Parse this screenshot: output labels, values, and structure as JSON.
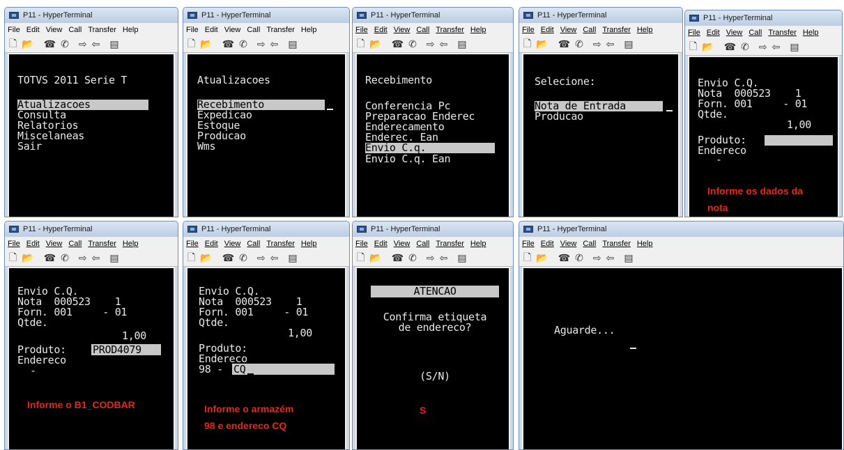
{
  "window_title": "P11 - HyperTerminal",
  "menu": [
    "File",
    "Edit",
    "View",
    "Call",
    "Transfer",
    "Help"
  ],
  "toolbar_icons": [
    "new-icon",
    "open-icon",
    "connect-icon",
    "disconnect-icon",
    "send-icon",
    "receive-icon",
    "properties-icon"
  ],
  "screens": {
    "s1": {
      "title": "TOTVS 2011 Serie T",
      "items": [
        "Atualizacoes",
        "Consulta",
        "Relatorios",
        "Miscelaneas",
        "Sair"
      ]
    },
    "s2": {
      "title": "Atualizacoes",
      "items": [
        "Recebimento",
        "Expedicao",
        "Estoque",
        "Producao",
        "Wms"
      ]
    },
    "s3": {
      "title": "Recebimento",
      "items": [
        "Conferencia Pc",
        "Preparacao Enderec",
        "Enderecamento",
        "Enderec. Ean",
        "Envio C.q.",
        "Envio C.q. Ean"
      ]
    },
    "s4": {
      "title": "Selecione:",
      "items": [
        "Nota de Entrada",
        "Producao"
      ]
    },
    "s5": {
      "lines": [
        "Envio C.Q.",
        "Nota  000523    1",
        "Forn. 001     - 01",
        "Qtde."
      ],
      "qty": "1,00",
      "produto_label": "Produto:",
      "produto_value": "",
      "endereco_label": "Endereco",
      "endereco_value": "-",
      "annotation": "Informe os dados da\nnota"
    },
    "s6": {
      "lines": [
        "Envio C.Q.",
        "Nota  000523    1",
        "Forn. 001     - 01",
        "Qtde."
      ],
      "qty": "1,00",
      "produto_label": "Produto:",
      "produto_value": "PROD4079",
      "endereco_label": "Endereco",
      "endereco_value": "-",
      "annotation": "Informe o B1_CODBAR"
    },
    "s7": {
      "lines": [
        "Envio C.Q.",
        "Nota  000523    1",
        "Forn. 001     - 01",
        "Qtde."
      ],
      "qty": "1,00",
      "produto_label": "Produto:",
      "endereco_label": "Endereco",
      "endereco_prefix": "98 - ",
      "endereco_value": "CQ",
      "annotation": "Informe o armazém\n98 e endereco CQ"
    },
    "s8": {
      "header": "ATENCAO",
      "question1": "Confirma etiqueta",
      "question2": "de endereco?",
      "prompt": "(S/N)",
      "annotation": "S"
    },
    "s9": {
      "message": "Aguarde..."
    }
  },
  "colors": {
    "annotation": "#e8261c",
    "terminal_bg": "#000000",
    "terminal_fg": "#e9e9e9",
    "highlight": "#c8c8c8"
  }
}
